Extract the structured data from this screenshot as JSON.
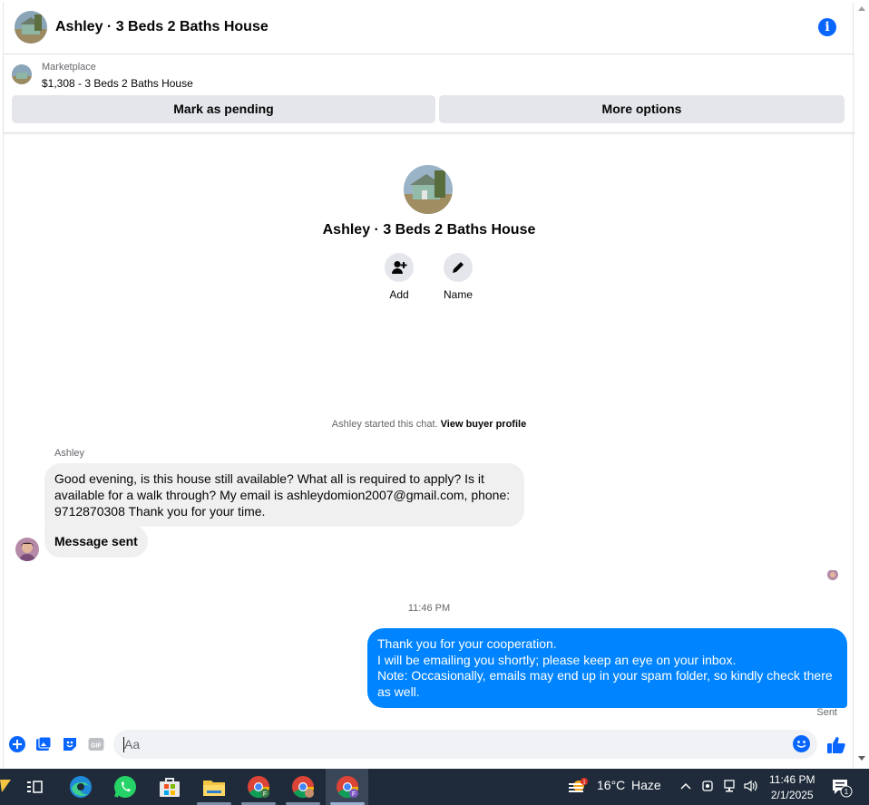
{
  "header": {
    "title": "Ashley · 3 Beds 2 Baths House",
    "info_icon": "info-icon"
  },
  "listing": {
    "source": "Marketplace",
    "price_title": "$1,308 - 3 Beds 2 Baths House",
    "pending_label": "Mark as pending",
    "more_label": "More options"
  },
  "profile": {
    "name": "Ashley · 3 Beds 2 Baths House",
    "add_label": "Add",
    "name_label": "Name"
  },
  "chat": {
    "started_text": "Ashley started this chat.",
    "buyer_link": "View buyer profile",
    "sender": "Ashley",
    "incoming_message": "Good evening, is this house still available? What all is required to apply? Is it available for a walk through? My email is ashleydomion2007@gmail.com, phone: 9712870308 Thank you for your time.",
    "system_message": "Message sent",
    "timestamp": "11:46 PM",
    "outgoing_line1": "Thank you for your cooperation.",
    "outgoing_line2": "I will be emailing you shortly; please keep an eye on your inbox.",
    "outgoing_line3": "Note: Occasionally, emails may end up in your spam folder, so kindly check there as well.",
    "status": "Sent"
  },
  "composer": {
    "placeholder": "Aa",
    "gif_label": "GIF"
  },
  "taskbar": {
    "weather_temp": "16°C",
    "weather_text": "Haze",
    "weather_badge": "1",
    "time": "11:46 PM",
    "date": "2/1/2025",
    "notification_count": "1",
    "chrome_profile_letter": "F"
  },
  "colors": {
    "accent": "#0866ff",
    "outgoing_bubble": "#0084ff",
    "incoming_bubble": "#f0f0f0",
    "taskbar": "#1f2b3a"
  }
}
